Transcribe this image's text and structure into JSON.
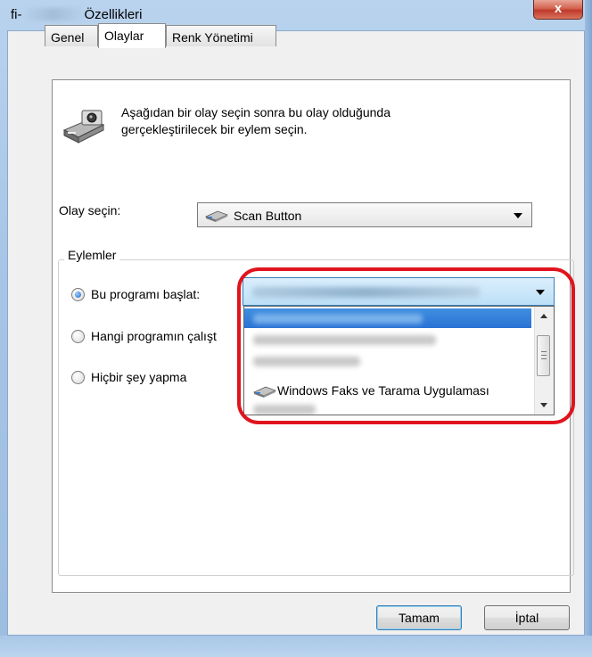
{
  "window": {
    "title_prefix": "fi-",
    "title_suffix": "Özellikleri",
    "close_label": "x"
  },
  "tabs": [
    {
      "label": "Genel",
      "active": false
    },
    {
      "label": "Olaylar",
      "active": true
    },
    {
      "label": "Renk Yönetimi",
      "active": false
    }
  ],
  "description": {
    "line1": "Aşağıdan bir olay seçin sonra bu olay olduğunda",
    "line2": "gerçekleştirilecek bir eylem seçin."
  },
  "event": {
    "label": "Olay seçin:",
    "selected": "Scan Button"
  },
  "actions": {
    "group_title": "Eylemler",
    "options": [
      {
        "label": "Bu programı başlat:",
        "checked": true
      },
      {
        "label": "Hangi programın çalışt",
        "checked": false
      },
      {
        "label": "Hiçbir şey yapma",
        "checked": false
      }
    ],
    "program_list": {
      "selected_text": "",
      "items": [
        {
          "text": "",
          "selected": true
        },
        {
          "text": "",
          "selected": false
        },
        {
          "text": "",
          "selected": false
        },
        {
          "text": "Windows Faks ve Tarama Uygulaması",
          "selected": false
        },
        {
          "text": "",
          "selected": false
        }
      ]
    }
  },
  "buttons": {
    "ok": "Tamam",
    "cancel": "İptal"
  },
  "colors": {
    "highlight": "#e0141e",
    "selection": "#2b72d4"
  }
}
